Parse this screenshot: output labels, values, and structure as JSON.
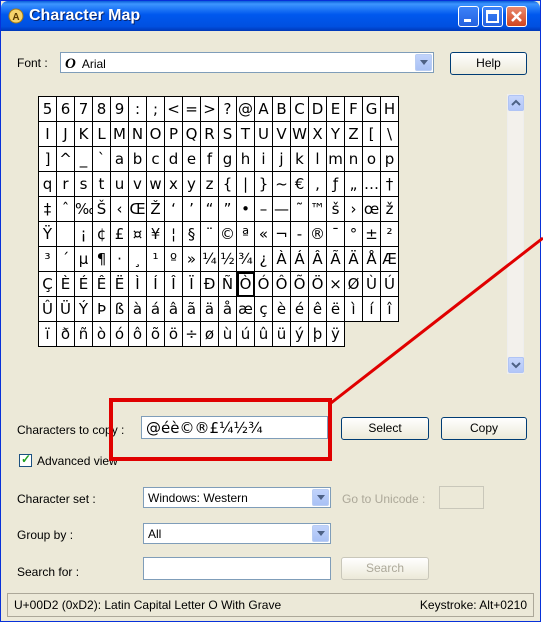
{
  "window": {
    "title": "Character Map"
  },
  "font": {
    "label": "Font :",
    "value": "Arial",
    "help_label": "Help"
  },
  "grid": {
    "rows": [
      [
        "5",
        "6",
        "7",
        "8",
        "9",
        ":",
        ";",
        "<",
        "=",
        ">",
        "?",
        "@",
        "A",
        "B",
        "C",
        "D",
        "E",
        "F",
        "G",
        "H"
      ],
      [
        "I",
        "J",
        "K",
        "L",
        "M",
        "N",
        "O",
        "P",
        "Q",
        "R",
        "S",
        "T",
        "U",
        "V",
        "W",
        "X",
        "Y",
        "Z",
        "[",
        "\\"
      ],
      [
        "]",
        "^",
        "_",
        "`",
        "a",
        "b",
        "c",
        "d",
        "e",
        "f",
        "g",
        "h",
        "i",
        "j",
        "k",
        "l",
        "m",
        "n",
        "o",
        "p"
      ],
      [
        "q",
        "r",
        "s",
        "t",
        "u",
        "v",
        "w",
        "x",
        "y",
        "z",
        "{",
        "|",
        "}",
        "~",
        "€",
        ",",
        "ƒ",
        "„",
        "…",
        "†"
      ],
      [
        "‡",
        "ˆ",
        "‰",
        "Š",
        "‹",
        "Œ",
        "Ž",
        "‘",
        "’",
        "“",
        "”",
        "•",
        "–",
        "—",
        "˜",
        "™",
        "š",
        "›",
        "œ",
        "ž"
      ],
      [
        "Ÿ",
        " ",
        "¡",
        "¢",
        "£",
        "¤",
        "¥",
        "¦",
        "§",
        "¨",
        "©",
        "ª",
        "«",
        "¬",
        "-",
        "®",
        "¯",
        "°",
        "±",
        "²"
      ],
      [
        "³",
        "´",
        "µ",
        "¶",
        "·",
        "¸",
        "¹",
        "º",
        "»",
        "¼",
        "½",
        "¾",
        "¿",
        "À",
        "Á",
        "Â",
        "Ã",
        "Ä",
        "Å",
        "Æ"
      ],
      [
        "Ç",
        "È",
        "É",
        "Ê",
        "Ë",
        "Ì",
        "Í",
        "Î",
        "Ï",
        "Ð",
        "Ñ",
        "Ò",
        "Ó",
        "Ô",
        "Õ",
        "Ö",
        "×",
        "Ø",
        "Ù",
        "Ú"
      ],
      [
        "Û",
        "Ü",
        "Ý",
        "Þ",
        "ß",
        "à",
        "á",
        "â",
        "ã",
        "ä",
        "å",
        "æ",
        "ç",
        "è",
        "é",
        "ê",
        "ë",
        "ì",
        "í",
        "î"
      ],
      [
        "ï",
        "ð",
        "ñ",
        "ò",
        "ó",
        "ô",
        "õ",
        "ö",
        "÷",
        "ø",
        "ù",
        "ú",
        "û",
        "ü",
        "ý",
        "þ",
        "ÿ"
      ]
    ]
  },
  "copy": {
    "label": "Characters to copy :",
    "value": "@éè©®£¼½¾",
    "select_label": "Select",
    "copy_label": "Copy"
  },
  "advanced": {
    "label": "Advanced view",
    "checked": true
  },
  "charset": {
    "label": "Character set :",
    "value": "Windows: Western",
    "goto_label": "Go to Unicode :"
  },
  "groupby": {
    "label": "Group by :",
    "value": "All"
  },
  "search": {
    "label": "Search for :",
    "value": "",
    "button_label": "Search"
  },
  "status": {
    "char_info": "U+00D2 (0xD2): Latin Capital Letter O With Grave",
    "keystroke": "Keystroke: Alt+0210"
  },
  "colors": {
    "titlebar": "#0058ee",
    "annotation_red": "#e00000",
    "checkmark": "#21a121"
  }
}
